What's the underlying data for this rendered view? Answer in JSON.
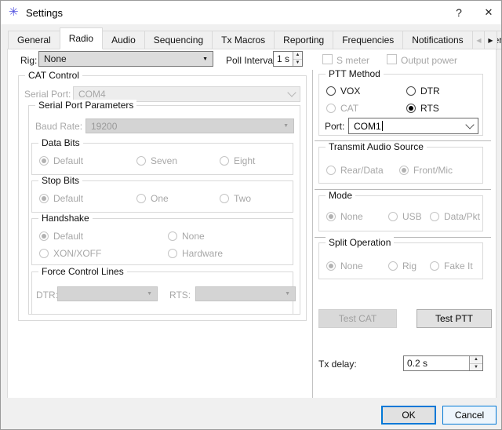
{
  "titlebar": {
    "title": "Settings"
  },
  "icons": {
    "app_star": "✳",
    "help": "?",
    "close": "✕",
    "dropdown_arrow": "▼",
    "spin_up": "▲",
    "spin_down": "▼",
    "tab_scroll_left": "◀",
    "tab_scroll_right": "▶"
  },
  "tabs": {
    "labels": [
      "General",
      "Radio",
      "Audio",
      "Sequencing",
      "Tx Macros",
      "Reporting",
      "Frequencies",
      "Notifications",
      "Filters"
    ],
    "selected": "Radio"
  },
  "rig": {
    "label": "Rig:",
    "value": "None"
  },
  "poll": {
    "label": "Poll Interval:",
    "value": "1 s"
  },
  "smeter": {
    "label": "S meter",
    "checked": false
  },
  "outpower": {
    "label": "Output power",
    "checked": false
  },
  "cat": {
    "title": "CAT Control",
    "serial_port": {
      "label": "Serial Port:",
      "value": "COM4"
    },
    "spp": {
      "title": "Serial Port Parameters",
      "baud": {
        "label": "Baud Rate:",
        "value": "19200"
      },
      "data_bits": {
        "title": "Data Bits",
        "options": [
          "Default",
          "Seven",
          "Eight"
        ],
        "selected": "Default"
      },
      "stop_bits": {
        "title": "Stop Bits",
        "options": [
          "Default",
          "One",
          "Two"
        ],
        "selected": "Default"
      },
      "handshake": {
        "title": "Handshake",
        "options": [
          "Default",
          "None",
          "XON/XOFF",
          "Hardware"
        ],
        "selected": "Default"
      },
      "force": {
        "title": "Force Control Lines",
        "dtr": {
          "label": "DTR:",
          "value": ""
        },
        "rts": {
          "label": "RTS:",
          "value": ""
        }
      }
    }
  },
  "ptt": {
    "title": "PTT Method",
    "options": [
      "VOX",
      "DTR",
      "CAT",
      "RTS"
    ],
    "selected": "RTS",
    "disabled_options": [
      "CAT"
    ],
    "port": {
      "label": "Port:",
      "value": "COM1"
    }
  },
  "tas": {
    "title": "Transmit Audio Source",
    "options": [
      "Rear/Data",
      "Front/Mic"
    ],
    "selected": "Front/Mic"
  },
  "mode": {
    "title": "Mode",
    "options": [
      "None",
      "USB",
      "Data/Pkt"
    ],
    "selected": "None"
  },
  "split": {
    "title": "Split Operation",
    "options": [
      "None",
      "Rig",
      "Fake It"
    ],
    "selected": "None"
  },
  "buttons": {
    "test_cat": "Test CAT",
    "test_ptt": "Test PTT",
    "ok": "OK",
    "cancel": "Cancel"
  },
  "tx_delay": {
    "label": "Tx delay:",
    "value": "0.2 s"
  },
  "colors": {
    "accent": "#0078d7",
    "disabled_text": "#a7a7a7",
    "dialog_bg": "#f0f0f0"
  }
}
